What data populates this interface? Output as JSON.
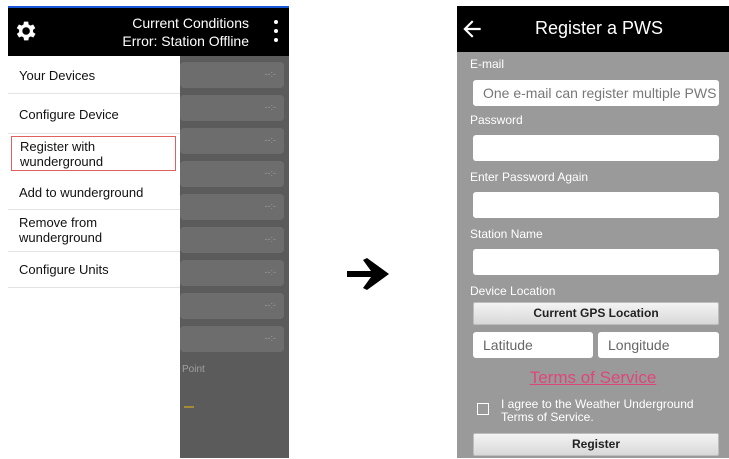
{
  "left": {
    "title_line1": "Current Conditions",
    "title_line2": "Error: Station Offline",
    "drawer_items": [
      {
        "label_line1": "Your Devices",
        "label_line2": ""
      },
      {
        "label_line1": "Configure Device",
        "label_line2": ""
      },
      {
        "label_line1": "Register with",
        "label_line2": "wunderground"
      },
      {
        "label_line1": "Add to wunderground",
        "label_line2": ""
      },
      {
        "label_line1": "Remove from",
        "label_line2": "wunderground"
      },
      {
        "label_line1": "Configure Units",
        "label_line2": ""
      }
    ],
    "background_value": "--:-",
    "background_label": "Point"
  },
  "right": {
    "title": "Register a PWS",
    "email_label": "E-mail",
    "email_placeholder": "One e-mail can register multiple PWS",
    "password_label": "Password",
    "password_again_label": "Enter Password Again",
    "station_name_label": "Station Name",
    "device_location_label": "Device Location",
    "gps_button": "Current GPS Location",
    "latitude_placeholder": "Latitude",
    "longitude_placeholder": "Longitude",
    "terms_link": "Terms of Service",
    "agree_text": "I agree to the Weather Underground Terms of Service.",
    "register_button": "Register"
  },
  "colors": {
    "link_pink": "#e0457a",
    "highlight_red": "#e06060",
    "form_gray": "#9a9a9a",
    "app_bar": "#000000"
  },
  "icons": {
    "left_gear": "gear-icon",
    "left_menu": "kebab-menu-icon",
    "transition": "right-arrow-icon",
    "right_back": "back-arrow-icon"
  }
}
